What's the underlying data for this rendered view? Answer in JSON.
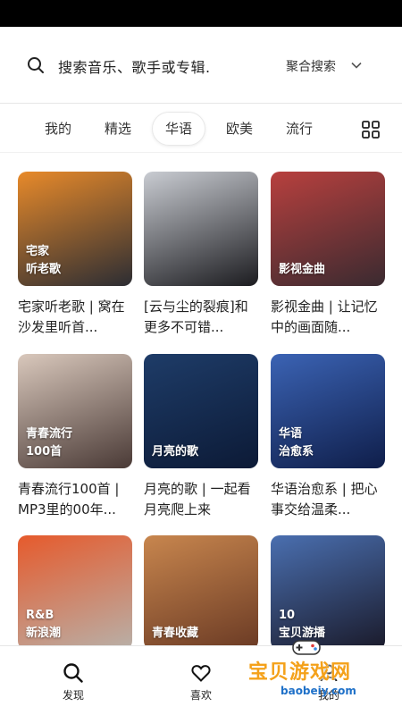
{
  "search": {
    "placeholder": "搜索音乐、歌手或专辑.",
    "mode_label": "聚合搜索"
  },
  "tabs": [
    {
      "label": "我的",
      "active": false
    },
    {
      "label": "精选",
      "active": false
    },
    {
      "label": "华语",
      "active": true
    },
    {
      "label": "欧美",
      "active": false
    },
    {
      "label": "流行",
      "active": false
    }
  ],
  "playlists": [
    {
      "cover_label": "宅家\n听老歌",
      "title": "宅家听老歌 | 窝在沙发里听首...",
      "colors": [
        "#e88a2a",
        "#2c2d33"
      ]
    },
    {
      "cover_label": "",
      "title": "[云与尘的裂痕]和更多不可错...",
      "colors": [
        "#c9ccd2",
        "#1c1c20"
      ]
    },
    {
      "cover_label": "影视金曲",
      "title": "影视金曲 | 让记忆中的画面随...",
      "colors": [
        "#b8403e",
        "#3a2a30"
      ]
    },
    {
      "cover_label": "青春流行\n100首",
      "title": "青春流行100首 | MP3里的00年...",
      "colors": [
        "#d9c8bc",
        "#4a3a36"
      ]
    },
    {
      "cover_label": "月亮的歌",
      "title": "月亮的歌 | 一起看月亮爬上来",
      "colors": [
        "#1e3c68",
        "#0c1a36"
      ]
    },
    {
      "cover_label": "华语\n治愈系",
      "title": "华语治愈系 | 把心事交给温柔...",
      "colors": [
        "#3b63b4",
        "#0f1e4a"
      ]
    },
    {
      "cover_label": "R&B\n新浪潮",
      "title": "",
      "colors": [
        "#e65a2c",
        "#b8b0a8"
      ]
    },
    {
      "cover_label": "青春收藏",
      "title": "",
      "colors": [
        "#c8864e",
        "#6a3a24"
      ]
    },
    {
      "cover_label": "10\n宝贝游播",
      "title": "",
      "colors": [
        "#4a6fb0",
        "#1a1a2a"
      ]
    }
  ],
  "bottom_nav": [
    {
      "label": "发现",
      "icon": "search-icon"
    },
    {
      "label": "喜欢",
      "icon": "heart-icon"
    },
    {
      "label": "我的",
      "icon": "profile-icon"
    }
  ],
  "watermark": {
    "text": "宝贝游戏网",
    "url": "baobeiy.com"
  }
}
